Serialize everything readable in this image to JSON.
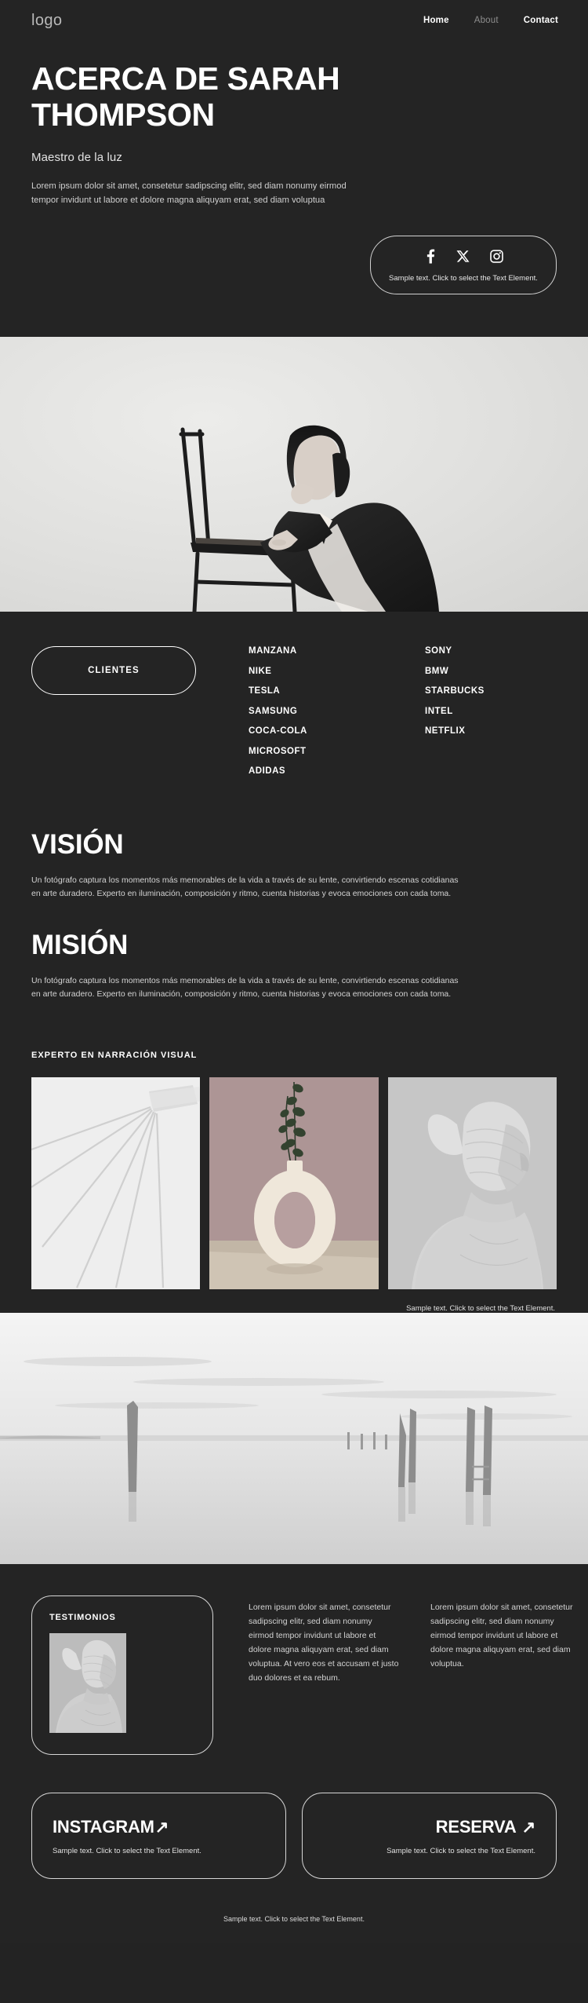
{
  "header": {
    "logo": "logo",
    "nav": [
      {
        "label": "Home",
        "muted": false
      },
      {
        "label": "About",
        "muted": true
      },
      {
        "label": "Contact",
        "muted": false
      }
    ]
  },
  "hero": {
    "title": "ACERCA DE SARAH THOMPSON",
    "subtitle": "Maestro de la luz",
    "lead": "Lorem ipsum dolor sit amet, consetetur sadipscing elitr, sed diam nonumy eirmod tempor invidunt ut labore et dolore magna aliquyam erat, sed diam voluptua",
    "social": {
      "icons": [
        "facebook-icon",
        "x-twitter-icon",
        "instagram-icon"
      ],
      "note": "Sample text. Click to select the Text Element."
    },
    "photo_alt": "Black and white portrait of a woman in an oversized blazer leaning on a wooden chair"
  },
  "clients": {
    "button_label": "CLIENTES",
    "column_one": [
      "MANZANA",
      "NIKE",
      "TESLA",
      "SAMSUNG",
      "COCA-COLA",
      "MICROSOFT",
      "ADIDAS"
    ],
    "column_two": [
      "SONY",
      "BMW",
      "STARBUCKS",
      "INTEL",
      "NETFLIX"
    ]
  },
  "vision": {
    "heading": "VISIÓN",
    "body": "Un fotógrafo captura los momentos más memorables de la vida a través de su lente, convirtiendo escenas cotidianas en arte duradero. Experto en iluminación, composición y ritmo, cuenta historias y evoca emociones con cada toma."
  },
  "mission": {
    "heading": "MISIÓN",
    "body": "Un fotógrafo captura los momentos más memorables de la vida a través de su lente, convirtiendo escenas cotidianas en arte duradero. Experto en iluminación, composición y ritmo, cuenta historias y evoca emociones con cada toma."
  },
  "gallery": {
    "heading": "EXPERTO EN NARRACIÓN VISUAL",
    "items": [
      {
        "alt": "Minimal architectural lines and shadows on a pale wall"
      },
      {
        "alt": "Cream oval ceramic vase with dried eucalyptus stems on mauve backdrop"
      },
      {
        "alt": "Portrait of a figure wrapped in translucent fabric, profile view"
      }
    ],
    "caption": "Sample text. Click to select the Text Element."
  },
  "landscape": {
    "alt": "Long exposure black and white seascape with weathered wooden posts in still water"
  },
  "testimonials": {
    "card_title": "TESTIMONIOS",
    "photo_alt": "Portrait of a figure draped in sheer fabric, looking upward",
    "quotes": [
      "Lorem ipsum dolor sit amet, consetetur sadipscing elitr, sed diam nonumy eirmod tempor invidunt ut labore et dolore magna aliquyam erat, sed diam voluptua. At vero eos et accusam et justo duo dolores et ea rebum.",
      "Lorem ipsum dolor sit amet, consetetur sadipscing elitr, sed diam nonumy eirmod tempor invidunt ut labore et dolore magna aliquyam erat, sed diam voluptua."
    ]
  },
  "cta": {
    "instagram": {
      "title": "INSTAGRAM",
      "arrow": "↗",
      "note": "Sample text. Click to select the Text Element."
    },
    "reserva": {
      "title": "RESERVA",
      "arrow": "↗",
      "note": "Sample text. Click to select the Text Element."
    }
  },
  "footer": {
    "note": "Sample text. Click to select the Text Element."
  },
  "colors": {
    "background": "#242424",
    "text": "#ffffff",
    "muted_text": "#8e8e8e",
    "border": "#d6d6d6"
  }
}
